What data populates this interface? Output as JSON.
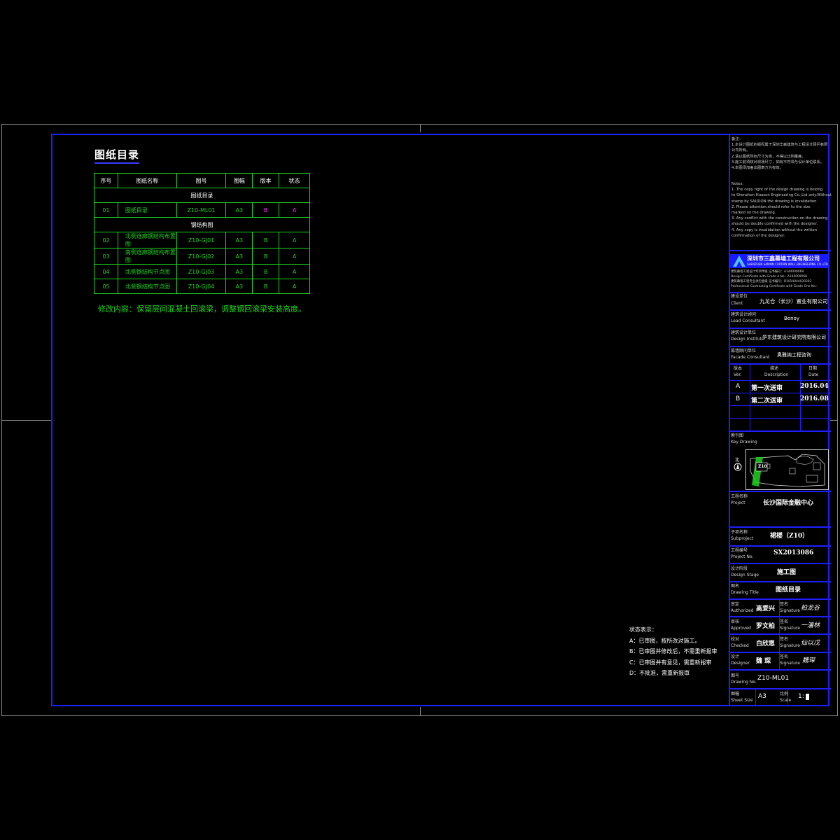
{
  "index": {
    "title": "图纸目录",
    "headers": [
      "序号",
      "图纸名称",
      "图号",
      "图幅",
      "版本",
      "状态"
    ],
    "groups": [
      "图纸目录",
      "钢结构图"
    ],
    "rows": [
      {
        "no": "01",
        "name": "图纸目录",
        "code": "Z10-ML01",
        "size": "A3",
        "ver": "B",
        "status": "A"
      },
      {
        "no": "02",
        "name": "北侧连廊钢结构布置图",
        "code": "Z10-GJ01",
        "size": "A3",
        "ver": "B",
        "status": "A"
      },
      {
        "no": "03",
        "name": "南侧连廊钢结构布置图",
        "code": "Z10-GJ02",
        "size": "A3",
        "ver": "B",
        "status": "A"
      },
      {
        "no": "04",
        "name": "北侧钢结构节点图",
        "code": "Z10-GJ03",
        "size": "A3",
        "ver": "B",
        "status": "A"
      },
      {
        "no": "05",
        "name": "北侧钢结构节点图",
        "code": "Z10-GJ04",
        "size": "A3",
        "ver": "B",
        "status": "A"
      }
    ],
    "revision_note": "修改内容：保留层间混凝土回滚梁，调整钢回滚梁安装高度。"
  },
  "status_legend": {
    "title": "状态表示：",
    "items": [
      "A：已审图，按所改对施工。",
      "B：已审图并修改后，不需重新报审",
      "C：已审图并有意见，需重新报审",
      "D：不批准，需重新报审"
    ]
  },
  "titleblock": {
    "notes_cn": [
      "备注：",
      "1.本设计图纸的版权属于深圳华森建筑与工程设计顾问有限",
      "公司所有。",
      "2.请以图纸所标尺寸为准，不得以比例量度。",
      "3.施工前须核对现场尺寸，如有不符须与设计单位联系。",
      "4.本图须加盖出图章方为有效。"
    ],
    "notes_en": [
      "Notes:",
      "1. The copy right of the design drawing is belong",
      "to Shenzhen Huasen Engineering Co.,Ltd only.Without",
      "stamp by SAUDON the drawing is invalidation.",
      "2. Please attention,should refer to the size",
      "marked on the drawing.",
      "3. Any conflict with the construction on the drawing",
      "should be double confirmed with the designer.",
      "4. Any copy is invalidation without the written",
      "confirmation of the designer."
    ],
    "company_name": "深圳市三鑫幕墙工程有限公司",
    "company_en": "SHENZHEN SANXIN CURTAIN WALL ENGINEERING CO.,LTD.",
    "company_info": [
      "建筑幕墙工程设计专项甲级 证书编号：A144009068",
      "Design Certificate with Grade A No.: A144009068",
      "建筑幕墙工程专业承包壹级 证书编号：B1014044030303",
      "Professional Contracting Certificate with Grade One No.:"
    ],
    "client_label": "建设单位",
    "client_label_en": "Client",
    "client": "九龙仓（长沙）置业有限公司",
    "consultant_label": "建筑设计顾问",
    "consultant_label_en": "Lead Consultant",
    "consultant": "Benoy",
    "design_institute_label": "建筑设计单位",
    "design_institute_label_en": "Design Institute",
    "design_institute": "华东建筑设计研究院有限公司",
    "facade_label": "幕墙顾问单位",
    "facade_label_en": "Facade Consultant",
    "facade": "奥雅纳工程咨询",
    "revisions": {
      "headers_cn": [
        "版本",
        "描述",
        "日期"
      ],
      "headers_en": [
        "Ver.",
        "Description",
        "Date"
      ],
      "rows": [
        {
          "ver": "A",
          "desc": "第一次送审",
          "date": "2016.04"
        },
        {
          "ver": "B",
          "desc": "第二次送审",
          "date": "2016.08"
        }
      ]
    },
    "keyplan_label": "索引图",
    "keyplan_label_en": "Key Drawing",
    "keyplan_zone": "Z10",
    "keyplan_north": "北",
    "project_label": "工程名称",
    "project_label_en": "Project",
    "project": "长沙国际金融中心",
    "subproject_label": "子项名称",
    "subproject_label_en": "Subproject",
    "subproject": "裙楼（Z10）",
    "project_no_label": "工程编号",
    "project_no_label_en": "Project No.",
    "project_no": "SX2013086",
    "stage_label": "设计阶段",
    "stage_label_en": "Design Stage",
    "stage": "施工图",
    "drawing_title_label": "图名",
    "drawing_title_label_en": "Drawing Title",
    "drawing_title": "图纸目录",
    "signature_label": "签名",
    "signature_label_en": "Signature",
    "roles": [
      {
        "label": "审定",
        "label_en": "Authorized",
        "name": "高爱兴",
        "sign": "柏龙谷"
      },
      {
        "label": "审核",
        "label_en": "Approved",
        "name": "罗文柏",
        "sign": "一潘林"
      },
      {
        "label": "校对",
        "label_en": "Checked",
        "name": "白欣恩",
        "sign": "仙以戊"
      },
      {
        "label": "设计",
        "label_en": "Designer",
        "name": "魏 琛",
        "sign": "魏琛"
      }
    ],
    "drawing_no_label": "图号",
    "drawing_no_label_en": "Drawing No.",
    "drawing_no": "Z10-ML01",
    "sheet_size_label": "图幅",
    "sheet_size_label_en": "Sheet Size",
    "sheet_size": "A3",
    "scale_label": "比例",
    "scale_label_en": "Scale",
    "scale": "1:"
  },
  "colors": {
    "frame": "#1e1eff",
    "table_lines": "#1fd41f",
    "highlight": "#ff2bff"
  }
}
